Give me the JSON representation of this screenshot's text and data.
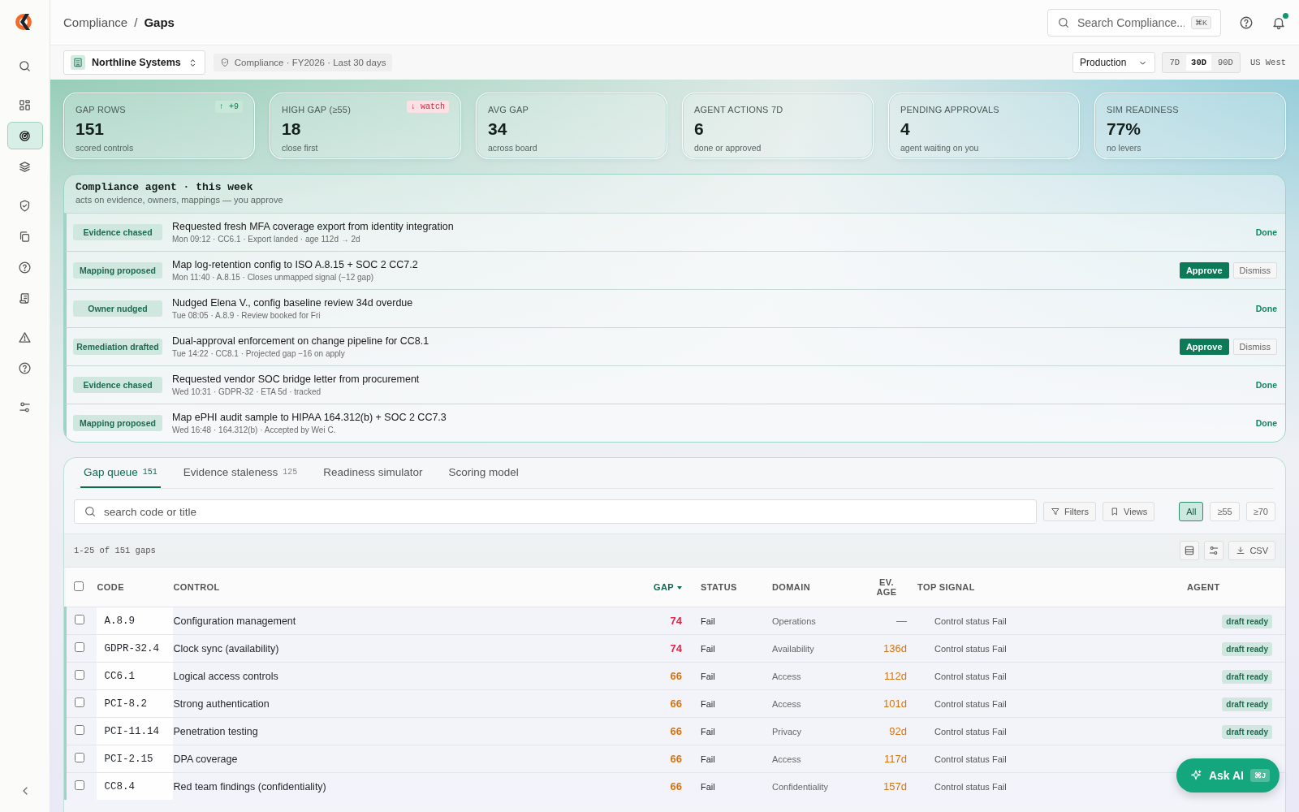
{
  "sidebar": {
    "items": [
      {
        "selected": false
      },
      {
        "selected": false
      },
      {
        "selected": true
      },
      {
        "selected": false
      },
      {
        "selected": false
      },
      {
        "selected": false
      },
      {
        "selected": false
      },
      {
        "selected": false
      },
      {
        "selected": false
      },
      {
        "selected": false
      },
      {
        "selected": false
      }
    ]
  },
  "breadcrumb": {
    "items": [
      "Compliance",
      "Gaps"
    ],
    "separator": "/"
  },
  "search": {
    "placeholder": "Search Compliance...",
    "shortcut": "⌘K"
  },
  "notifications": {
    "unread": true
  },
  "org": {
    "name": "Northline Systems"
  },
  "context": "Compliance · FY2026 · Last 30 days",
  "environment": "Production",
  "ranges": [
    {
      "label": "7D",
      "selected": false
    },
    {
      "label": "30D",
      "selected": true
    },
    {
      "label": "90D",
      "selected": false
    }
  ],
  "region": "US West",
  "kpis": [
    {
      "label": "GAP ROWS",
      "value": "151",
      "sub": "scored controls",
      "badge": {
        "text": "↑ +9",
        "positive": true
      }
    },
    {
      "label": "HIGH GAP (≥55)",
      "value": "18",
      "sub": "close first",
      "badge": {
        "text": "↓ watch",
        "positive": false
      }
    },
    {
      "label": "AVG GAP",
      "value": "34",
      "sub": "across board"
    },
    {
      "label": "AGENT ACTIONS 7D",
      "value": "6",
      "sub": "done or approved"
    },
    {
      "label": "PENDING APPROVALS",
      "value": "4",
      "sub": "agent waiting on you"
    },
    {
      "label": "SIM READINESS",
      "value": "77%",
      "sub": "no levers"
    }
  ],
  "agent": {
    "title": "Compliance agent · this week",
    "subtitle": "acts on evidence, owners, mappings — you approve",
    "actions": [
      {
        "tag": "Evidence chased",
        "title": "Requested fresh MFA coverage export from identity integration",
        "meta": "Mon 09:12 · CC6.1 · Export landed · age 112d → 2d",
        "kind": "done",
        "status": "Done"
      },
      {
        "tag": "Mapping proposed",
        "title": "Map log-retention config to ISO A.8.15 + SOC 2 CC7.2",
        "meta": "Mon 11:40 · A.8.15 · Closes unmapped signal (−12 gap)",
        "kind": "pending",
        "approve": "Approve",
        "dismiss": "Dismiss"
      },
      {
        "tag": "Owner nudged",
        "title": "Nudged Elena V., config baseline review 34d overdue",
        "meta": "Tue 08:05 · A.8.9 · Review booked for Fri",
        "kind": "done",
        "status": "Done"
      },
      {
        "tag": "Remediation drafted",
        "title": "Dual-approval enforcement on change pipeline for CC8.1",
        "meta": "Tue 14:22 · CC8.1 · Projected gap −16 on apply",
        "kind": "pending",
        "approve": "Approve",
        "dismiss": "Dismiss"
      },
      {
        "tag": "Evidence chased",
        "title": "Requested vendor SOC bridge letter from procurement",
        "meta": "Wed 10:31 · GDPR-32 · ETA 5d · tracked",
        "kind": "done",
        "status": "Done"
      },
      {
        "tag": "Mapping proposed",
        "title": "Map ePHI audit sample to HIPAA 164.312(b) + SOC 2 CC7.3",
        "meta": "Wed 16:48 · 164.312(b) · Accepted by Wei C.",
        "kind": "done",
        "status": "Done"
      }
    ]
  },
  "tabs": [
    {
      "label": "Gap queue",
      "count": "151",
      "selected": true
    },
    {
      "label": "Evidence staleness",
      "count": "125",
      "selected": false
    },
    {
      "label": "Readiness simulator",
      "selected": false
    },
    {
      "label": "Scoring model",
      "selected": false
    }
  ],
  "filter": {
    "placeholder": "search code or title",
    "filters": "Filters",
    "views": "Views",
    "thresholds": [
      {
        "label": "All",
        "selected": true
      },
      {
        "label": "≥55",
        "selected": false
      },
      {
        "label": "≥70",
        "selected": false
      }
    ]
  },
  "table": {
    "summary": "1-25 of 151 gaps",
    "export": "CSV",
    "all_checked": false,
    "columns": [
      {
        "label": "CODE",
        "sorted": false
      },
      {
        "label": "CONTROL",
        "sorted": false
      },
      {
        "label": "GAP",
        "sorted": true
      },
      {
        "label": "STATUS",
        "sorted": false
      },
      {
        "label": "DOMAIN",
        "sorted": false
      },
      {
        "label": "EV. AGE",
        "sorted": false
      },
      {
        "label": "TOP SIGNAL",
        "sorted": false
      },
      {
        "label": "AGENT",
        "sorted": false
      }
    ],
    "rows": [
      {
        "checked": false,
        "code": "A.8.9",
        "control": "Configuration management",
        "gap": "74",
        "critical": true,
        "status": "Fail",
        "domain": "Operations",
        "ev_age": "—",
        "evidence_missing": true,
        "top_signal": "Control status Fail",
        "agent": "draft ready"
      },
      {
        "checked": false,
        "code": "GDPR-32.4",
        "control": "Clock sync (availability)",
        "gap": "74",
        "critical": true,
        "status": "Fail",
        "domain": "Availability",
        "ev_age": "136d",
        "evidence_missing": false,
        "top_signal": "Control status Fail",
        "agent": "draft ready"
      },
      {
        "checked": false,
        "code": "CC6.1",
        "control": "Logical access controls",
        "gap": "66",
        "critical": false,
        "status": "Fail",
        "domain": "Access",
        "ev_age": "112d",
        "evidence_missing": false,
        "top_signal": "Control status Fail",
        "agent": "draft ready"
      },
      {
        "checked": false,
        "code": "PCI-8.2",
        "control": "Strong authentication",
        "gap": "66",
        "critical": false,
        "status": "Fail",
        "domain": "Access",
        "ev_age": "101d",
        "evidence_missing": false,
        "top_signal": "Control status Fail",
        "agent": "draft ready"
      },
      {
        "checked": false,
        "code": "PCI-11.14",
        "control": "Penetration testing",
        "gap": "66",
        "critical": false,
        "status": "Fail",
        "domain": "Privacy",
        "ev_age": "92d",
        "evidence_missing": false,
        "top_signal": "Control status Fail",
        "agent": "draft ready"
      },
      {
        "checked": false,
        "code": "PCI-2.15",
        "control": "DPA coverage",
        "gap": "66",
        "critical": false,
        "status": "Fail",
        "domain": "Access",
        "ev_age": "117d",
        "evidence_missing": false,
        "top_signal": "Control status Fail"
      },
      {
        "checked": false,
        "code": "CC8.4",
        "control": "Red team findings (confidentiality)",
        "gap": "66",
        "critical": false,
        "status": "Fail",
        "domain": "Confidentiality",
        "ev_age": "157d",
        "evidence_missing": false,
        "top_signal": "Control status Fail"
      }
    ]
  },
  "assistant": {
    "label": "Ask AI",
    "shortcut": "⌘J"
  }
}
